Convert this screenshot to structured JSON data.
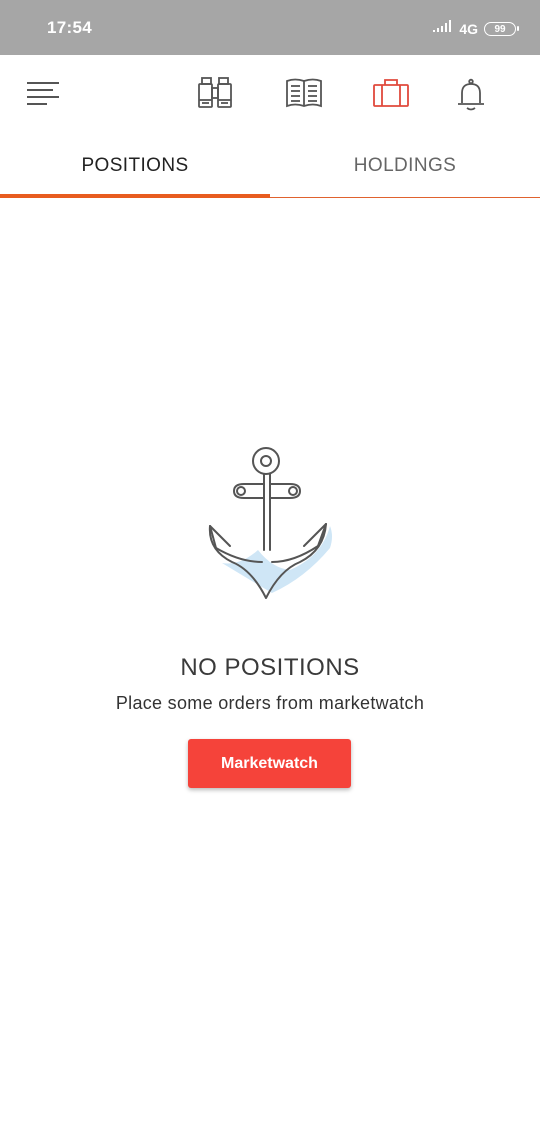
{
  "status_bar": {
    "time": "17:54",
    "network": "4G",
    "battery": "99"
  },
  "toolbar": {
    "icons": [
      "menu-icon",
      "binoculars-icon",
      "book-icon",
      "portfolio-icon",
      "bell-icon"
    ],
    "active_icon": "portfolio-icon",
    "icon_color": "#555555",
    "active_color": "#e0493c"
  },
  "tabs": [
    {
      "label": "POSITIONS",
      "active": true
    },
    {
      "label": "HOLDINGS",
      "active": false
    }
  ],
  "empty_state": {
    "icon": "anchor-icon",
    "title": "NO POSITIONS",
    "subtitle": "Place some orders from marketwatch",
    "button_label": "Marketwatch"
  },
  "colors": {
    "accent": "#e85c1f",
    "button": "#f5433a",
    "status_bar": "#a6a6a6",
    "anchor_shadow": "#cfe6f6"
  }
}
